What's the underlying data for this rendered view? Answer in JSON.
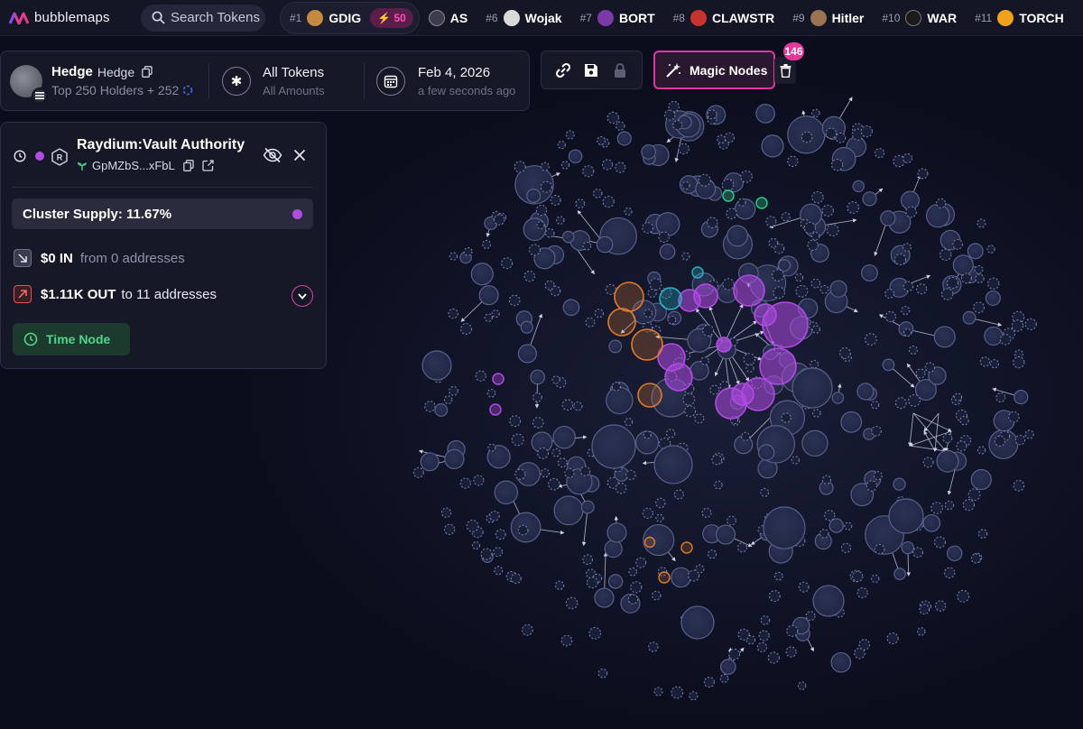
{
  "brand": {
    "name": "bubblemaps"
  },
  "search": {
    "label": "Search Tokens"
  },
  "trending": [
    {
      "rank": "#1",
      "name": "GDIG",
      "boost": "50",
      "icon_color": "#c48a3e"
    },
    {
      "rank": "",
      "name": "AS",
      "icon_color": "#3b3d4f"
    },
    {
      "rank": "#6",
      "name": "Wojak",
      "icon_color": "#d9d9d9"
    },
    {
      "rank": "#7",
      "name": "BORT",
      "icon_color": "#7a3aa8"
    },
    {
      "rank": "#8",
      "name": "CLAWSTR",
      "icon_color": "#c8332e"
    },
    {
      "rank": "#9",
      "name": "Hitler",
      "icon_color": "#9a7450"
    },
    {
      "rank": "#10",
      "name": "WAR",
      "icon_color": "#1b1b1b"
    },
    {
      "rank": "#11",
      "name": "TORCH",
      "icon_color": "#f0a21a"
    }
  ],
  "token": {
    "symbol": "Hedge",
    "name": "Hedge",
    "holders": "Top 250 Holders + 252",
    "tokens_label": "All Tokens",
    "amounts_label": "All Amounts",
    "date": "Feb 4, 2026",
    "date_relative": "a few seconds ago"
  },
  "toolbar": {
    "magic_label": "Magic Nodes",
    "magic_count": "146"
  },
  "panel": {
    "title": "Raydium:Vault Authority",
    "address": "GpMZbS...xFbL",
    "cluster_supply": "Cluster Supply: 11.67%",
    "in_amount": "$0 IN",
    "in_desc": "from 0 addresses",
    "out_amount": "$1.11K OUT",
    "out_desc": "to 11 addresses",
    "time_node": "Time Node"
  },
  "colors": {
    "background": "#0b0d1c",
    "node": "#2a3150",
    "node_stroke": "#56608a",
    "purple": "#b04be3",
    "orange": "#e07a2a",
    "teal": "#27b4c4",
    "green": "#2fcf86",
    "magenta": "#e0379e"
  }
}
